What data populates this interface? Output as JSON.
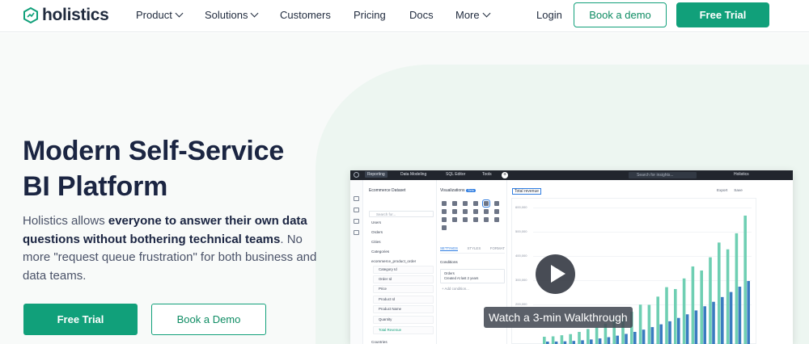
{
  "nav": {
    "brand": "holistics",
    "items": [
      {
        "label": "Product",
        "has_dropdown": true
      },
      {
        "label": "Solutions",
        "has_dropdown": true
      },
      {
        "label": "Customers",
        "has_dropdown": false
      },
      {
        "label": "Pricing",
        "has_dropdown": false
      },
      {
        "label": "Docs",
        "has_dropdown": false
      },
      {
        "label": "More",
        "has_dropdown": true
      }
    ],
    "login": "Login",
    "book_demo": "Book a demo",
    "free_trial": "Free Trial"
  },
  "hero": {
    "title_line1": "Modern Self-Service",
    "title_line2": "BI Platform",
    "lead_1": "Holistics allows ",
    "lead_bold": "everyone to answer their own data questions without bothering technical teams",
    "lead_2": ". No more \"request queue frustration\" for both business and data teams.",
    "cta_trial": "Free Trial",
    "cta_demo": "Book a Demo"
  },
  "preview": {
    "tabs": [
      "Reporting",
      "Data Modeling",
      "SQL Editor",
      "Tools"
    ],
    "search_placeholder": "Search for insights...",
    "org": "Holistics",
    "dataset": "Ecommerce Dataset",
    "dataset_search": "Search for...",
    "models": [
      "Users",
      "Orders",
      "Cities",
      "Categories",
      "ecommerce_product_order"
    ],
    "fields": [
      "Category Id",
      "Order Id",
      "Price",
      "Product Id",
      "Product Name",
      "Quantity",
      "Total Revenue"
    ],
    "extra_model": "Countries",
    "viz_title": "Visualizations",
    "viz_badge": "Beta",
    "viz_tabs": [
      "SETTINGS",
      "STYLES",
      "FORMAT"
    ],
    "conditions_label": "Conditions",
    "condition_field": "Orders",
    "condition_value": "Created At last 2 years",
    "add_condition": "+ Add condition...",
    "chart_tag": "Total revenue",
    "export": "Export",
    "save": "Save",
    "y_ticks": [
      "600,000",
      "500,000",
      "400,000",
      "300,000",
      "200,000"
    ],
    "walkthrough": "Watch a 3-min Walkthrough"
  },
  "colors": {
    "brand_green": "#11a07a",
    "bar_teal": "#6fcfb3",
    "bar_blue": "#3a7cc0"
  }
}
